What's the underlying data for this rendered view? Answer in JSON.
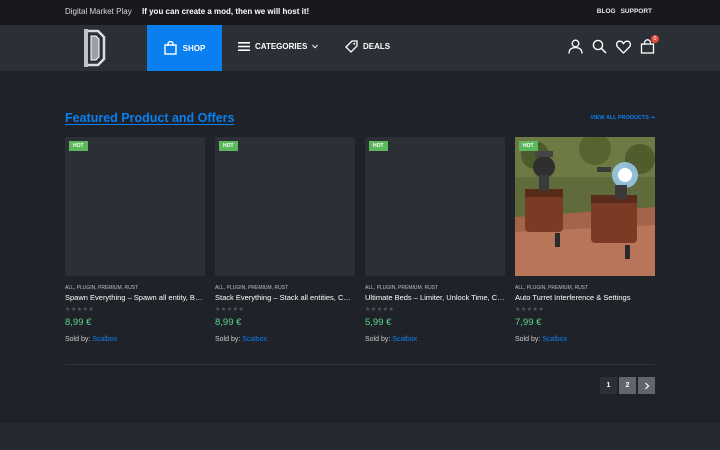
{
  "topbar": {
    "brand": "Digital Market Play",
    "promo": "If you can create a mod, then we will host it!",
    "links": [
      "BLOG",
      "SUPPORT"
    ]
  },
  "nav": {
    "shop": "SHOP",
    "categories": "CATEGORIES",
    "deals": "DEALS",
    "cart_count": "0"
  },
  "section": {
    "title": "Featured Product and Offers",
    "view_all": "VIEW ALL PRODUCTS ➞"
  },
  "products": [
    {
      "badge": "HOT",
      "categories": "ALL, PLUGIN, PREMIUM, RUST",
      "name": "Spawn Everything – Spawn all entity, Build Spawner",
      "stars": "★★★★★",
      "price": "8,99 €",
      "sold_by_label": "Sold by:",
      "seller": "Scalbox"
    },
    {
      "badge": "HOT",
      "categories": "ALL, PLUGIN, PREMIUM, RUST",
      "name": "Stack Everything – Stack all entities, Customize",
      "stars": "★★★★★",
      "price": "8,99 €",
      "sold_by_label": "Sold by:",
      "seller": "Scalbox"
    },
    {
      "badge": "HOT",
      "categories": "ALL, PLUGIN, PREMIUM, RUST",
      "name": "Ultimate Beds – Limiter, Unlock Time, Cooldown",
      "stars": "★★★★★",
      "price": "5,99 €",
      "sold_by_label": "Sold by:",
      "seller": "Scalbox"
    },
    {
      "badge": "HOT",
      "categories": "ALL, PLUGIN, PREMIUM, RUST",
      "name": "Auto Turret Interference & Settings",
      "stars": "★★★★★",
      "price": "7,99 €",
      "sold_by_label": "Sold by:",
      "seller": "Scalbox"
    }
  ],
  "pagination": {
    "pages": [
      "1",
      "2"
    ],
    "current": "1"
  },
  "colors": {
    "accent": "#0a7ff0",
    "price": "#5cd68a",
    "hot": "#5cb85c",
    "background": "#1f2228"
  }
}
